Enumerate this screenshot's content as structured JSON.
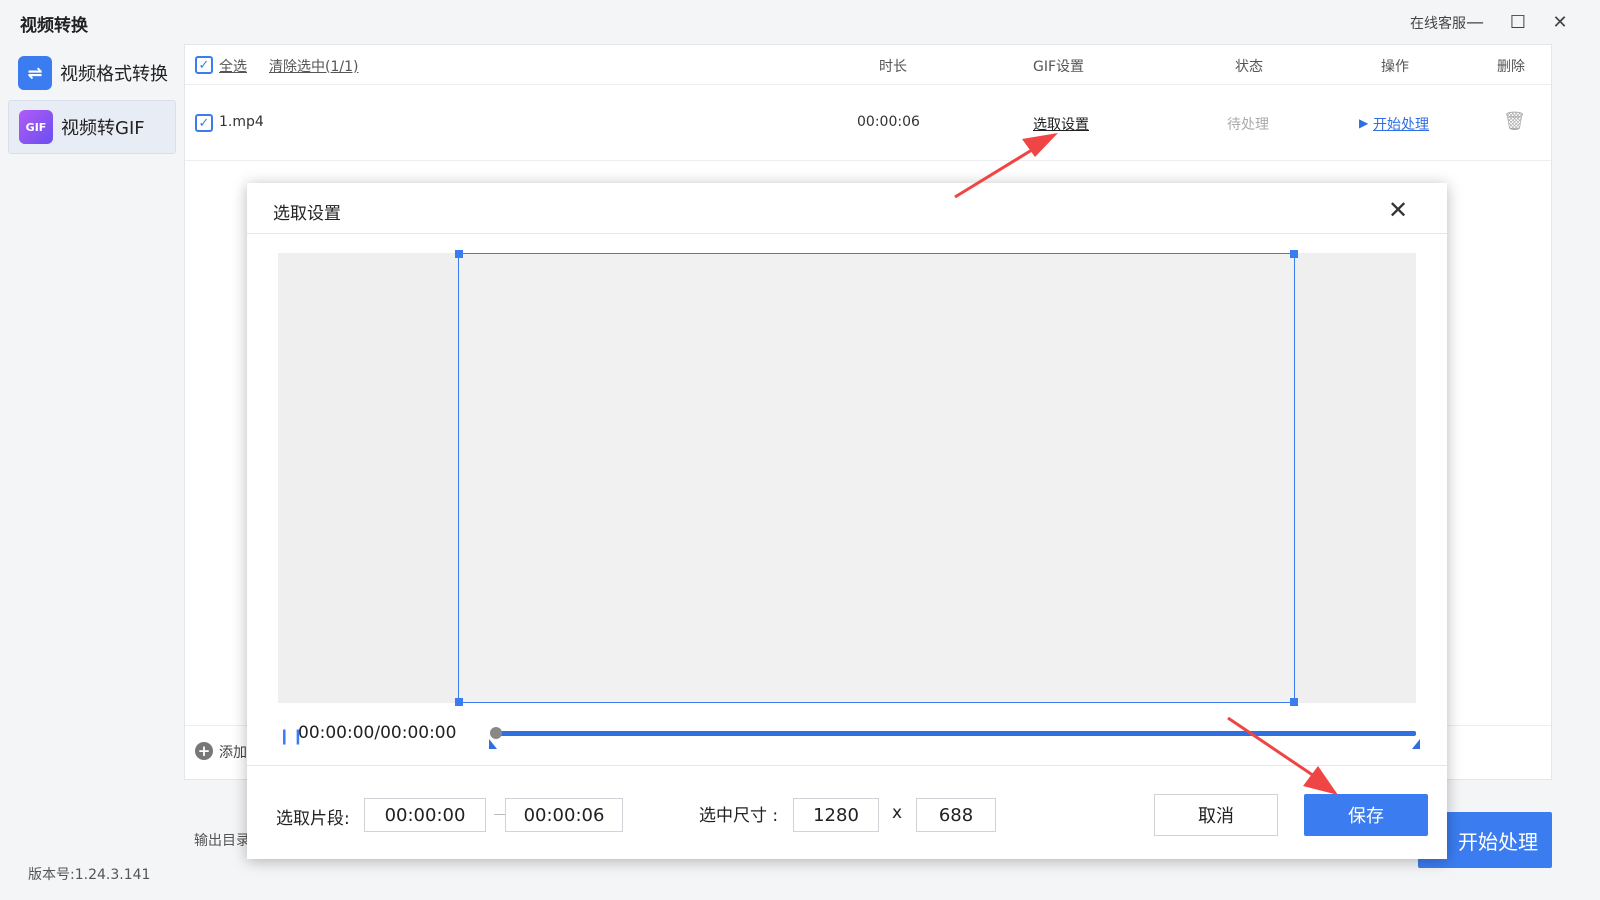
{
  "window": {
    "title": "视频转换",
    "online_service": "在线客服",
    "minimize": "—",
    "maximize": "☐",
    "close": "✕"
  },
  "sidebar": {
    "items": [
      {
        "label": "视频格式转换",
        "icon": "swap-arrows-icon",
        "icon_glyph": "⇌"
      },
      {
        "label": "视频转GIF",
        "icon": "gif-icon",
        "icon_glyph": "GIF"
      }
    ],
    "version": "版本号:1.24.3.141",
    "output_dir_label": "输出目录"
  },
  "file_list": {
    "select_all": "全选",
    "clear_selection": "清除选中(1/1)",
    "columns": [
      "时长",
      "GIF设置",
      "状态",
      "操作",
      "删除"
    ],
    "rows": [
      {
        "name": "1.mp4",
        "duration": "00:00:06",
        "gif_setting": "选取设置",
        "status": "待处理",
        "action": "开始处理"
      }
    ],
    "add_label": "添加"
  },
  "start_button": "开始处理",
  "dialog": {
    "title": "选取设置",
    "close": "✕",
    "pause_glyph": "❙❙",
    "timecode": "00:00:00/00:00:00",
    "segment_label": "选取片段:",
    "segment_start": "00:00:00",
    "segment_end": "00:00:06",
    "size_label": "选中尺寸 :",
    "width": "1280",
    "times": "x",
    "height": "688",
    "cancel": "取消",
    "save": "保存"
  },
  "colors": {
    "accent": "#3b7cf0",
    "annotation": "#f04545"
  }
}
